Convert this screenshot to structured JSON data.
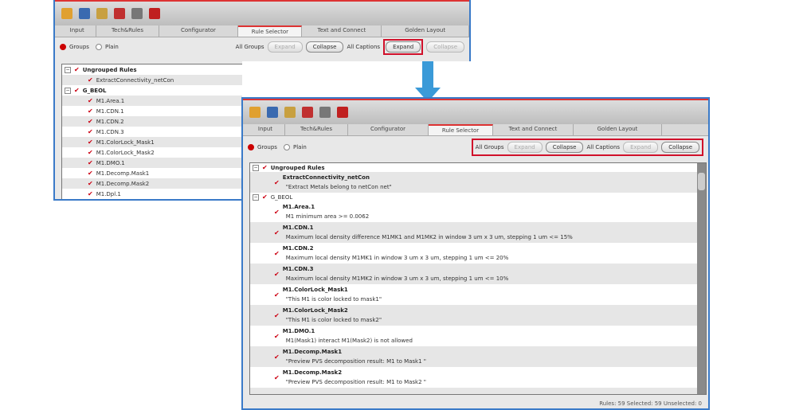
{
  "toolbar_icons": [
    "open-folder-icon",
    "save-icon",
    "wizard-icon",
    "clear-icon",
    "settings-icon",
    "flow-icon"
  ],
  "tabs": [
    "Input",
    "Tech&Rules",
    "Configurator",
    "Rule Selector",
    "Text and Connect",
    "Golden Layout"
  ],
  "active_tab": "Rule Selector",
  "view": {
    "groups": "Groups",
    "plain": "Plain"
  },
  "all_groups": "All Groups",
  "all_captions": "All Captions",
  "expand": "Expand",
  "collapse": "Collapse",
  "window1_tree": [
    {
      "label": "Ungrouped Rules",
      "level": 0,
      "group": true
    },
    {
      "label": "ExtractConnectivity_netCon",
      "level": 1
    },
    {
      "label": "G_BEOL",
      "level": 0,
      "group": true
    },
    {
      "label": "M1.Area.1",
      "level": 1
    },
    {
      "label": "M1.CDN.1",
      "level": 1
    },
    {
      "label": "M1.CDN.2",
      "level": 1
    },
    {
      "label": "M1.CDN.3",
      "level": 1
    },
    {
      "label": "M1.ColorLock_Mask1",
      "level": 1
    },
    {
      "label": "M1.ColorLock_Mask2",
      "level": 1
    },
    {
      "label": "M1.DMO.1",
      "level": 1
    },
    {
      "label": "M1.Decomp.Mask1",
      "level": 1
    },
    {
      "label": "M1.Decomp.Mask2",
      "level": 1
    },
    {
      "label": "M1.Dpl.1",
      "level": 1
    }
  ],
  "window2_tree": [
    {
      "group": "Ungrouped Rules",
      "rules": [
        {
          "name": "ExtractConnectivity_netCon",
          "caption": "\"Extract Metals belong to netCon net\""
        }
      ]
    },
    {
      "group": "G_BEOL",
      "rules": [
        {
          "name": "M1.Area.1",
          "caption": "M1 minimum area >= 0.0062"
        },
        {
          "name": "M1.CDN.1",
          "caption": "Maximum local density difference M1MK1 and M1MK2 in window 3 um x 3 um, stepping 1 um <= 15%"
        },
        {
          "name": "M1.CDN.2",
          "caption": "Maximum local density  M1MK1 in window 3 um x 3 um, stepping 1 um <= 20%"
        },
        {
          "name": "M1.CDN.3",
          "caption": "Maximum local density  M1MK2 in window 3 um x 3 um, stepping 1 um <= 10%"
        },
        {
          "name": "M1.ColorLock_Mask1",
          "caption": "\"This M1 is color locked to mask1\""
        },
        {
          "name": "M1.ColorLock_Mask2",
          "caption": "\"This M1 is color locked to mask2\""
        },
        {
          "name": "M1.DMO.1",
          "caption": "M1(Mask1) interact M1(Mask2) is not allowed"
        },
        {
          "name": "M1.Decomp.Mask1",
          "caption": "\"Preview PVS decomposition result: M1 to Mask1 \""
        },
        {
          "name": "M1.Decomp.Mask2",
          "caption": "\"Preview PVS decomposition result: M1 to Mask2 \""
        },
        {
          "name": "M1.Dpl.1",
          "caption": ""
        }
      ]
    }
  ],
  "status": "Rules: 59  Selected: 59  Unselected: 0"
}
